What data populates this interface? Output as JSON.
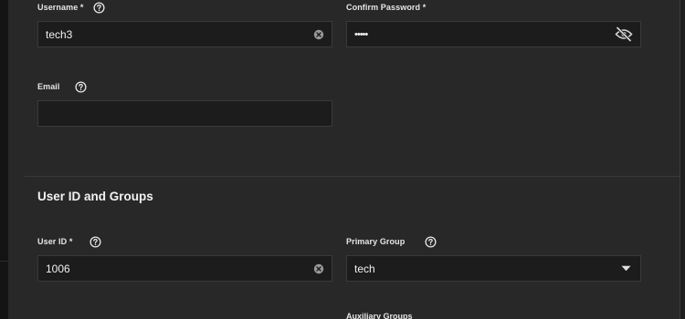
{
  "form": {
    "username": {
      "label": "Username *",
      "value": "tech3"
    },
    "confirm_password": {
      "label": "Confirm Password *",
      "value": "•••••"
    },
    "email": {
      "label": "Email",
      "value": ""
    },
    "section_title": "User ID and Groups",
    "user_id": {
      "label": "User ID *",
      "value": "1006"
    },
    "primary_group": {
      "label": "Primary Group",
      "value": "tech"
    },
    "aux_groups": {
      "label": "Auxiliary Groups"
    }
  },
  "icons": {
    "help": "help-circle-icon",
    "clear": "clear-circle-icon",
    "password_visibility": "eye-off-icon",
    "dropdown": "caret-down-icon"
  },
  "colors": {
    "panel_bg": "#282828",
    "input_bg": "#1c1c1c",
    "border": "#3a3a3a",
    "text": "#e8e8e8"
  }
}
